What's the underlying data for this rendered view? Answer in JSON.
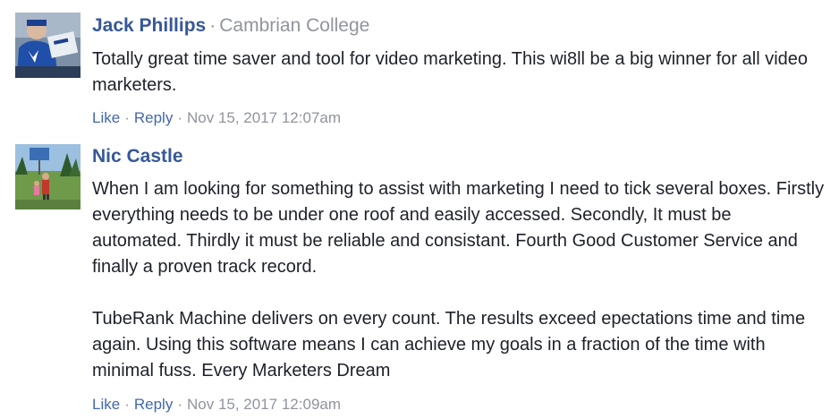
{
  "comments": [
    {
      "author": "Jack Phillips",
      "affiliation": "Cambrian College",
      "paragraphs": [
        "Totally great time saver and tool for video marketing. This wi8ll be a big winner for all video marketers."
      ],
      "actions": {
        "like": "Like",
        "reply": "Reply",
        "timestamp": "Nov 15, 2017 12:07am"
      }
    },
    {
      "author": "Nic Castle",
      "paragraphs": [
        "When I am looking for something to assist with marketing I need to tick several boxes. Firstly everything needs to be under one roof and easily accessed. Secondly, It must be automated. Thirdly it must be reliable and consistant. Fourth Good Customer Service and finally a proven track record.",
        "TubeRank Machine delivers on every count. The results exceed epectations time and time again. Using this software means I can achieve my goals in a fraction of the time with minimal fuss. Every Marketers Dream"
      ],
      "actions": {
        "like": "Like",
        "reply": "Reply",
        "timestamp": "Nov 15, 2017 12:09am"
      }
    }
  ],
  "separator": "·",
  "colors": {
    "author_link": "#365899",
    "action_link": "#4267b2",
    "muted": "#90949c",
    "text": "#1d2129"
  }
}
